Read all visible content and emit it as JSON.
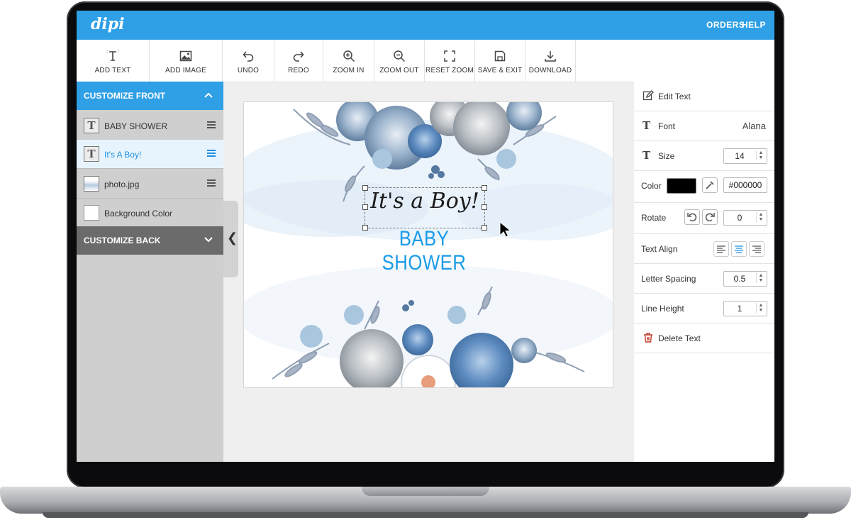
{
  "header": {
    "logo": "dipi",
    "nav": [
      "ORDERS",
      "HELP"
    ]
  },
  "toolbar": {
    "items": [
      {
        "label": "ADD TEXT",
        "icon": "add-text-icon"
      },
      {
        "label": "ADD IMAGE",
        "icon": "image-icon"
      },
      {
        "label": "UNDO",
        "icon": "undo-icon"
      },
      {
        "label": "REDO",
        "icon": "redo-icon"
      },
      {
        "label": "ZOOM IN",
        "icon": "zoom-in-icon"
      },
      {
        "label": "ZOOM OUT",
        "icon": "zoom-out-icon"
      },
      {
        "label": "RESET ZOOM",
        "icon": "reset-zoom-icon"
      },
      {
        "label": "SAVE & EXIT",
        "icon": "save-icon"
      },
      {
        "label": "DOWNLOAD",
        "icon": "download-icon"
      }
    ]
  },
  "left_panel": {
    "front_header": "CUSTOMIZE FRONT",
    "layers": [
      {
        "name": "BABY SHOWER",
        "type": "text",
        "selected": false
      },
      {
        "name": "It's A Boy!",
        "type": "text",
        "selected": true
      },
      {
        "name": "photo.jpg",
        "type": "image",
        "selected": false
      },
      {
        "name": "Background Color",
        "type": "color",
        "selected": false
      }
    ],
    "back_header": "CUSTOMIZE BACK",
    "collapse_glyph": "❮"
  },
  "canvas": {
    "script_text": "It's a Boy!",
    "title_text": "BABY SHOWER"
  },
  "right_panel": {
    "edit_text": "Edit Text",
    "font_label": "Font",
    "font_value": "Alana",
    "size_label": "Size",
    "size_value": "14",
    "color_label": "Color",
    "color_value": "#000000",
    "rotate_label": "Rotate",
    "rotate_value": "0",
    "text_align_label": "Text Align",
    "letter_spacing_label": "Letter Spacing",
    "letter_spacing_value": "0.5",
    "line_height_label": "Line Height",
    "line_height_value": "1",
    "delete_text": "Delete Text"
  },
  "colors": {
    "accent": "#2f9fe6",
    "title_blue": "#1a9be6",
    "back_header": "#6b6b6b",
    "delete_red": "#c0392b"
  }
}
